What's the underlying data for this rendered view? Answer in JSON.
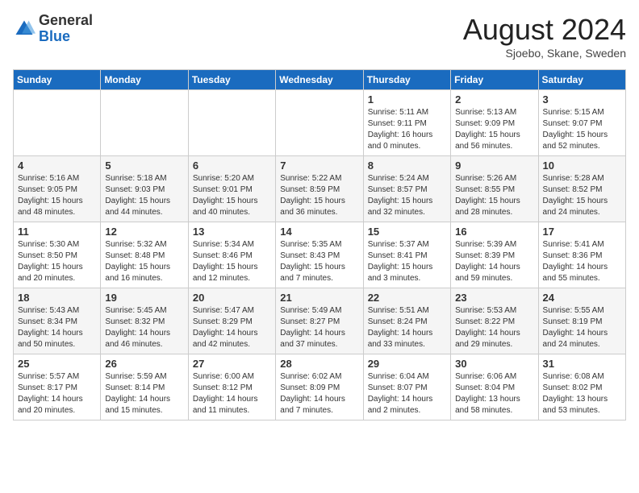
{
  "logo": {
    "general": "General",
    "blue": "Blue"
  },
  "title": "August 2024",
  "location": "Sjoebo, Skane, Sweden",
  "days_of_week": [
    "Sunday",
    "Monday",
    "Tuesday",
    "Wednesday",
    "Thursday",
    "Friday",
    "Saturday"
  ],
  "weeks": [
    [
      {
        "day": "",
        "info": ""
      },
      {
        "day": "",
        "info": ""
      },
      {
        "day": "",
        "info": ""
      },
      {
        "day": "",
        "info": ""
      },
      {
        "day": "1",
        "info": "Sunrise: 5:11 AM\nSunset: 9:11 PM\nDaylight: 16 hours\nand 0 minutes."
      },
      {
        "day": "2",
        "info": "Sunrise: 5:13 AM\nSunset: 9:09 PM\nDaylight: 15 hours\nand 56 minutes."
      },
      {
        "day": "3",
        "info": "Sunrise: 5:15 AM\nSunset: 9:07 PM\nDaylight: 15 hours\nand 52 minutes."
      }
    ],
    [
      {
        "day": "4",
        "info": "Sunrise: 5:16 AM\nSunset: 9:05 PM\nDaylight: 15 hours\nand 48 minutes."
      },
      {
        "day": "5",
        "info": "Sunrise: 5:18 AM\nSunset: 9:03 PM\nDaylight: 15 hours\nand 44 minutes."
      },
      {
        "day": "6",
        "info": "Sunrise: 5:20 AM\nSunset: 9:01 PM\nDaylight: 15 hours\nand 40 minutes."
      },
      {
        "day": "7",
        "info": "Sunrise: 5:22 AM\nSunset: 8:59 PM\nDaylight: 15 hours\nand 36 minutes."
      },
      {
        "day": "8",
        "info": "Sunrise: 5:24 AM\nSunset: 8:57 PM\nDaylight: 15 hours\nand 32 minutes."
      },
      {
        "day": "9",
        "info": "Sunrise: 5:26 AM\nSunset: 8:55 PM\nDaylight: 15 hours\nand 28 minutes."
      },
      {
        "day": "10",
        "info": "Sunrise: 5:28 AM\nSunset: 8:52 PM\nDaylight: 15 hours\nand 24 minutes."
      }
    ],
    [
      {
        "day": "11",
        "info": "Sunrise: 5:30 AM\nSunset: 8:50 PM\nDaylight: 15 hours\nand 20 minutes."
      },
      {
        "day": "12",
        "info": "Sunrise: 5:32 AM\nSunset: 8:48 PM\nDaylight: 15 hours\nand 16 minutes."
      },
      {
        "day": "13",
        "info": "Sunrise: 5:34 AM\nSunset: 8:46 PM\nDaylight: 15 hours\nand 12 minutes."
      },
      {
        "day": "14",
        "info": "Sunrise: 5:35 AM\nSunset: 8:43 PM\nDaylight: 15 hours\nand 7 minutes."
      },
      {
        "day": "15",
        "info": "Sunrise: 5:37 AM\nSunset: 8:41 PM\nDaylight: 15 hours\nand 3 minutes."
      },
      {
        "day": "16",
        "info": "Sunrise: 5:39 AM\nSunset: 8:39 PM\nDaylight: 14 hours\nand 59 minutes."
      },
      {
        "day": "17",
        "info": "Sunrise: 5:41 AM\nSunset: 8:36 PM\nDaylight: 14 hours\nand 55 minutes."
      }
    ],
    [
      {
        "day": "18",
        "info": "Sunrise: 5:43 AM\nSunset: 8:34 PM\nDaylight: 14 hours\nand 50 minutes."
      },
      {
        "day": "19",
        "info": "Sunrise: 5:45 AM\nSunset: 8:32 PM\nDaylight: 14 hours\nand 46 minutes."
      },
      {
        "day": "20",
        "info": "Sunrise: 5:47 AM\nSunset: 8:29 PM\nDaylight: 14 hours\nand 42 minutes."
      },
      {
        "day": "21",
        "info": "Sunrise: 5:49 AM\nSunset: 8:27 PM\nDaylight: 14 hours\nand 37 minutes."
      },
      {
        "day": "22",
        "info": "Sunrise: 5:51 AM\nSunset: 8:24 PM\nDaylight: 14 hours\nand 33 minutes."
      },
      {
        "day": "23",
        "info": "Sunrise: 5:53 AM\nSunset: 8:22 PM\nDaylight: 14 hours\nand 29 minutes."
      },
      {
        "day": "24",
        "info": "Sunrise: 5:55 AM\nSunset: 8:19 PM\nDaylight: 14 hours\nand 24 minutes."
      }
    ],
    [
      {
        "day": "25",
        "info": "Sunrise: 5:57 AM\nSunset: 8:17 PM\nDaylight: 14 hours\nand 20 minutes."
      },
      {
        "day": "26",
        "info": "Sunrise: 5:59 AM\nSunset: 8:14 PM\nDaylight: 14 hours\nand 15 minutes."
      },
      {
        "day": "27",
        "info": "Sunrise: 6:00 AM\nSunset: 8:12 PM\nDaylight: 14 hours\nand 11 minutes."
      },
      {
        "day": "28",
        "info": "Sunrise: 6:02 AM\nSunset: 8:09 PM\nDaylight: 14 hours\nand 7 minutes."
      },
      {
        "day": "29",
        "info": "Sunrise: 6:04 AM\nSunset: 8:07 PM\nDaylight: 14 hours\nand 2 minutes."
      },
      {
        "day": "30",
        "info": "Sunrise: 6:06 AM\nSunset: 8:04 PM\nDaylight: 13 hours\nand 58 minutes."
      },
      {
        "day": "31",
        "info": "Sunrise: 6:08 AM\nSunset: 8:02 PM\nDaylight: 13 hours\nand 53 minutes."
      }
    ]
  ]
}
